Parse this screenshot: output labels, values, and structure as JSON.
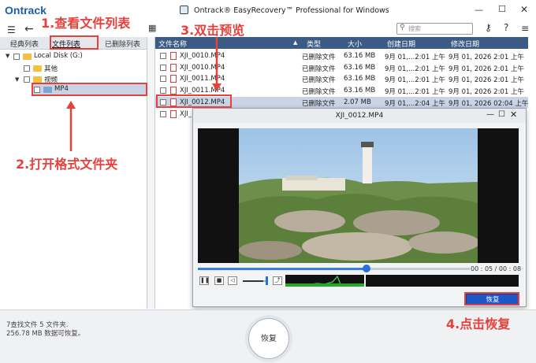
{
  "app": {
    "logo": "Ontrack",
    "title": "Ontrack® EasyRecovery™ Professional for Windows"
  },
  "toolbar": {
    "search_placeholder": "搜索"
  },
  "left": {
    "tabs": [
      "经典列表",
      "文件列表",
      "已删除列表"
    ],
    "tree": [
      {
        "label": "Local Disk (G:)"
      },
      {
        "label": "其他"
      },
      {
        "label": "视频"
      },
      {
        "label": "MP4"
      }
    ]
  },
  "table": {
    "headers": [
      "文件名称",
      "类型",
      "大小",
      "创建日期",
      "修改日期"
    ],
    "rows": [
      {
        "name": "XJI_0010.MP4",
        "type": "已删除文件",
        "size": "63.16 MB",
        "created": "9月 01,...2:01 上午",
        "modified": "9月 01, 2026 2:01 上午"
      },
      {
        "name": "XJI_0010.MP4",
        "type": "已删除文件",
        "size": "63.16 MB",
        "created": "9月 01,...2:01 上午",
        "modified": "9月 01, 2026 2:01 上午"
      },
      {
        "name": "XJI_0011.MP4",
        "type": "已删除文件",
        "size": "63.16 MB",
        "created": "9月 01,...2:01 上午",
        "modified": "9月 01, 2026 2:01 上午"
      },
      {
        "name": "XJI_0011.MP4",
        "type": "已删除文件",
        "size": "63.16 MB",
        "created": "9月 01,...2:01 上午",
        "modified": "9月 01, 2026 2:01 上午"
      },
      {
        "name": "XJI_0012.MP4",
        "type": "已删除文件",
        "size": "2.07 MB",
        "created": "9月 01,...2:04 上午",
        "modified": "9月 01, 2026 02:04 上午"
      },
      {
        "name": "XJI_",
        "type": "",
        "size": "",
        "created": "",
        "modified": ""
      }
    ]
  },
  "preview": {
    "title": "XJI_0012.MP4",
    "time": "00 : 05  /  00 : 08",
    "progress": 0.62,
    "volume": 0.85,
    "restore_label": "恢复"
  },
  "status": {
    "line1": "7查找文件 5 文件夹.",
    "line2": "256.78 MB 数据可恢复。"
  },
  "main_restore_label": "恢复",
  "annotations": {
    "step1": "1.查看文件列表",
    "step2": "2.打开格式文件夹",
    "step3": "3.双击预览",
    "step4": "4.点击恢复"
  },
  "colors": {
    "accent": "#3b5b86",
    "annotation": "#e8403b",
    "button": "#1e56c8"
  }
}
